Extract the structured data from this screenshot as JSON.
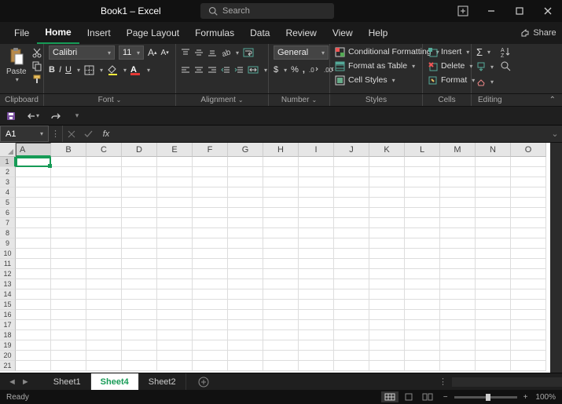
{
  "title": "Book1 – Excel",
  "search_placeholder": "Search",
  "share_label": "Share",
  "tabs": [
    "File",
    "Home",
    "Insert",
    "Page Layout",
    "Formulas",
    "Data",
    "Review",
    "View",
    "Help"
  ],
  "active_tab": "Home",
  "ribbon": {
    "paste_label": "Paste",
    "font_name": "Calibri",
    "font_size": "11",
    "number_format": "General",
    "conditional_formatting": "Conditional Formatting",
    "format_as_table": "Format as Table",
    "cell_styles": "Cell Styles",
    "insert": "Insert",
    "delete": "Delete",
    "format": "Format",
    "groups": [
      "Clipboard",
      "Font",
      "Alignment",
      "Number",
      "Styles",
      "Cells",
      "Editing"
    ]
  },
  "name_box": "A1",
  "columns": [
    "A",
    "B",
    "C",
    "D",
    "E",
    "F",
    "G",
    "H",
    "I",
    "J",
    "K",
    "L",
    "M",
    "N",
    "O"
  ],
  "row_count": 21,
  "sheets": [
    "Sheet1",
    "Sheet4",
    "Sheet2"
  ],
  "active_sheet": "Sheet4",
  "status": "Ready",
  "zoom": "100%"
}
